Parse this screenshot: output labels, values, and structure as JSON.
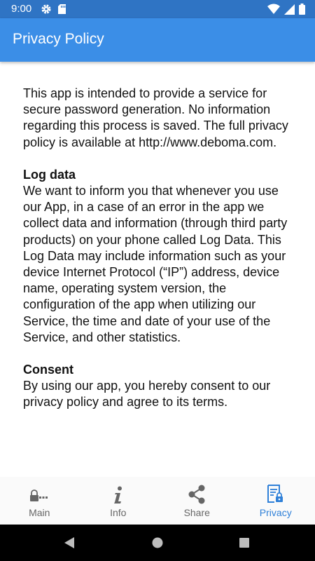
{
  "status_bar": {
    "time": "9:00",
    "icons": [
      "gear-icon",
      "sd-card-icon",
      "wifi-icon",
      "signal-icon",
      "battery-icon"
    ]
  },
  "app_bar": {
    "title": "Privacy Policy"
  },
  "content": {
    "intro": "This app is intended to provide a service for secure password generation. No information regarding this process is saved. The full privacy policy is available at http://www.deboma.com.",
    "log_data_heading": "Log data",
    "log_data_text": "We want to inform you that whenever you use our App, in a case of an error in the app we collect data and information (through third party products) on your phone called Log Data. This Log Data may include information such as your device Internet Protocol (“IP”) address, device name, operating system version, the configuration of the app when utilizing our Service, the time and date of your use of the Service, and other statistics.",
    "consent_heading": "Consent",
    "consent_text": "By using our app, you hereby consent to our privacy policy and agree to its terms."
  },
  "bottom_nav": {
    "items": [
      {
        "label": "Main",
        "icon": "password-lock-icon",
        "active": false
      },
      {
        "label": "Info",
        "icon": "info-icon",
        "active": false
      },
      {
        "label": "Share",
        "icon": "share-icon",
        "active": false
      },
      {
        "label": "Privacy",
        "icon": "privacy-document-icon",
        "active": true
      }
    ]
  },
  "colors": {
    "status_bar": "#2f74c4",
    "app_bar": "#3b8ee7",
    "active_tab": "#2f80d8",
    "inactive_tab": "#666666"
  },
  "system_nav": [
    "back-icon",
    "home-icon",
    "recents-icon"
  ]
}
